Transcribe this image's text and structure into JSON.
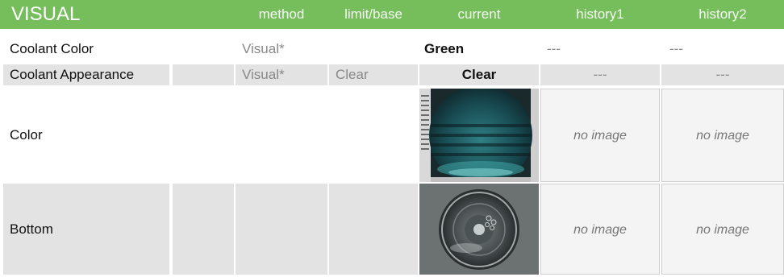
{
  "header": {
    "title": "VISUAL",
    "method": "method",
    "limit_base": "limit/base",
    "current": "current",
    "history1": "history1",
    "history2": "history2"
  },
  "rows": [
    {
      "label": "Coolant Color",
      "method": "Visual*",
      "limit": "",
      "current": "Green",
      "history1": "---",
      "history2": "---"
    },
    {
      "label": "Coolant Appearance",
      "method": "Visual*",
      "limit": "Clear",
      "current": "Clear",
      "history1": "---",
      "history2": "---"
    },
    {
      "label": "Color",
      "current_image": "coolant-color-photo",
      "history1": "no image",
      "history2": "no image"
    },
    {
      "label": "Bottom",
      "current_image": "coolant-bottom-photo",
      "history1": "no image",
      "history2": "no image"
    }
  ],
  "colors": {
    "header_bg": "#76bd5c",
    "shade": "#e3e3e3"
  }
}
